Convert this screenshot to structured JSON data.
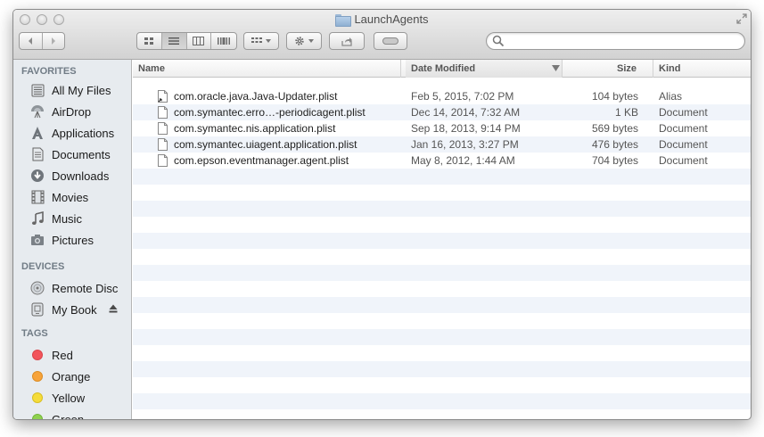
{
  "window": {
    "title": "LaunchAgents"
  },
  "search": {
    "placeholder": ""
  },
  "sidebar": {
    "favorites_header": "FAVORITES",
    "favorites": [
      {
        "label": "All My Files",
        "icon": "all-files-icon"
      },
      {
        "label": "AirDrop",
        "icon": "airdrop-icon"
      },
      {
        "label": "Applications",
        "icon": "applications-icon"
      },
      {
        "label": "Documents",
        "icon": "documents-icon"
      },
      {
        "label": "Downloads",
        "icon": "downloads-icon"
      },
      {
        "label": "Movies",
        "icon": "movies-icon"
      },
      {
        "label": "Music",
        "icon": "music-icon"
      },
      {
        "label": "Pictures",
        "icon": "pictures-icon"
      }
    ],
    "devices_header": "DEVICES",
    "devices": [
      {
        "label": "Remote Disc",
        "icon": "remote-disc-icon"
      },
      {
        "label": "My Book",
        "icon": "external-drive-icon"
      }
    ],
    "tags_header": "TAGS",
    "tags": [
      {
        "label": "Red",
        "color": "#f2545b"
      },
      {
        "label": "Orange",
        "color": "#f7a33a"
      },
      {
        "label": "Yellow",
        "color": "#f5dc3a"
      },
      {
        "label": "Green",
        "color": "#8fd14f"
      }
    ]
  },
  "columns": {
    "name": "Name",
    "date": "Date Modified",
    "size": "Size",
    "kind": "Kind"
  },
  "files": [
    {
      "name": "com.oracle.java.Java-Updater.plist",
      "date": "Feb 5, 2015, 7:02 PM",
      "size": "104 bytes",
      "kind": "Alias"
    },
    {
      "name": "com.symantec.erro…-periodicagent.plist",
      "date": "Dec 14, 2014, 7:32 AM",
      "size": "1 KB",
      "kind": "Document"
    },
    {
      "name": "com.symantec.nis.application.plist",
      "date": "Sep 18, 2013, 9:14 PM",
      "size": "569 bytes",
      "kind": "Document"
    },
    {
      "name": "com.symantec.uiagent.application.plist",
      "date": "Jan 16, 2013, 3:27 PM",
      "size": "476 bytes",
      "kind": "Document"
    },
    {
      "name": "com.epson.eventmanager.agent.plist",
      "date": "May 8, 2012, 1:44 AM",
      "size": "704 bytes",
      "kind": "Document"
    }
  ],
  "colors": {
    "sidebar_bg": "#e7ebef",
    "row_stripe": "#f0f4fa",
    "header_text": "#717c86"
  }
}
